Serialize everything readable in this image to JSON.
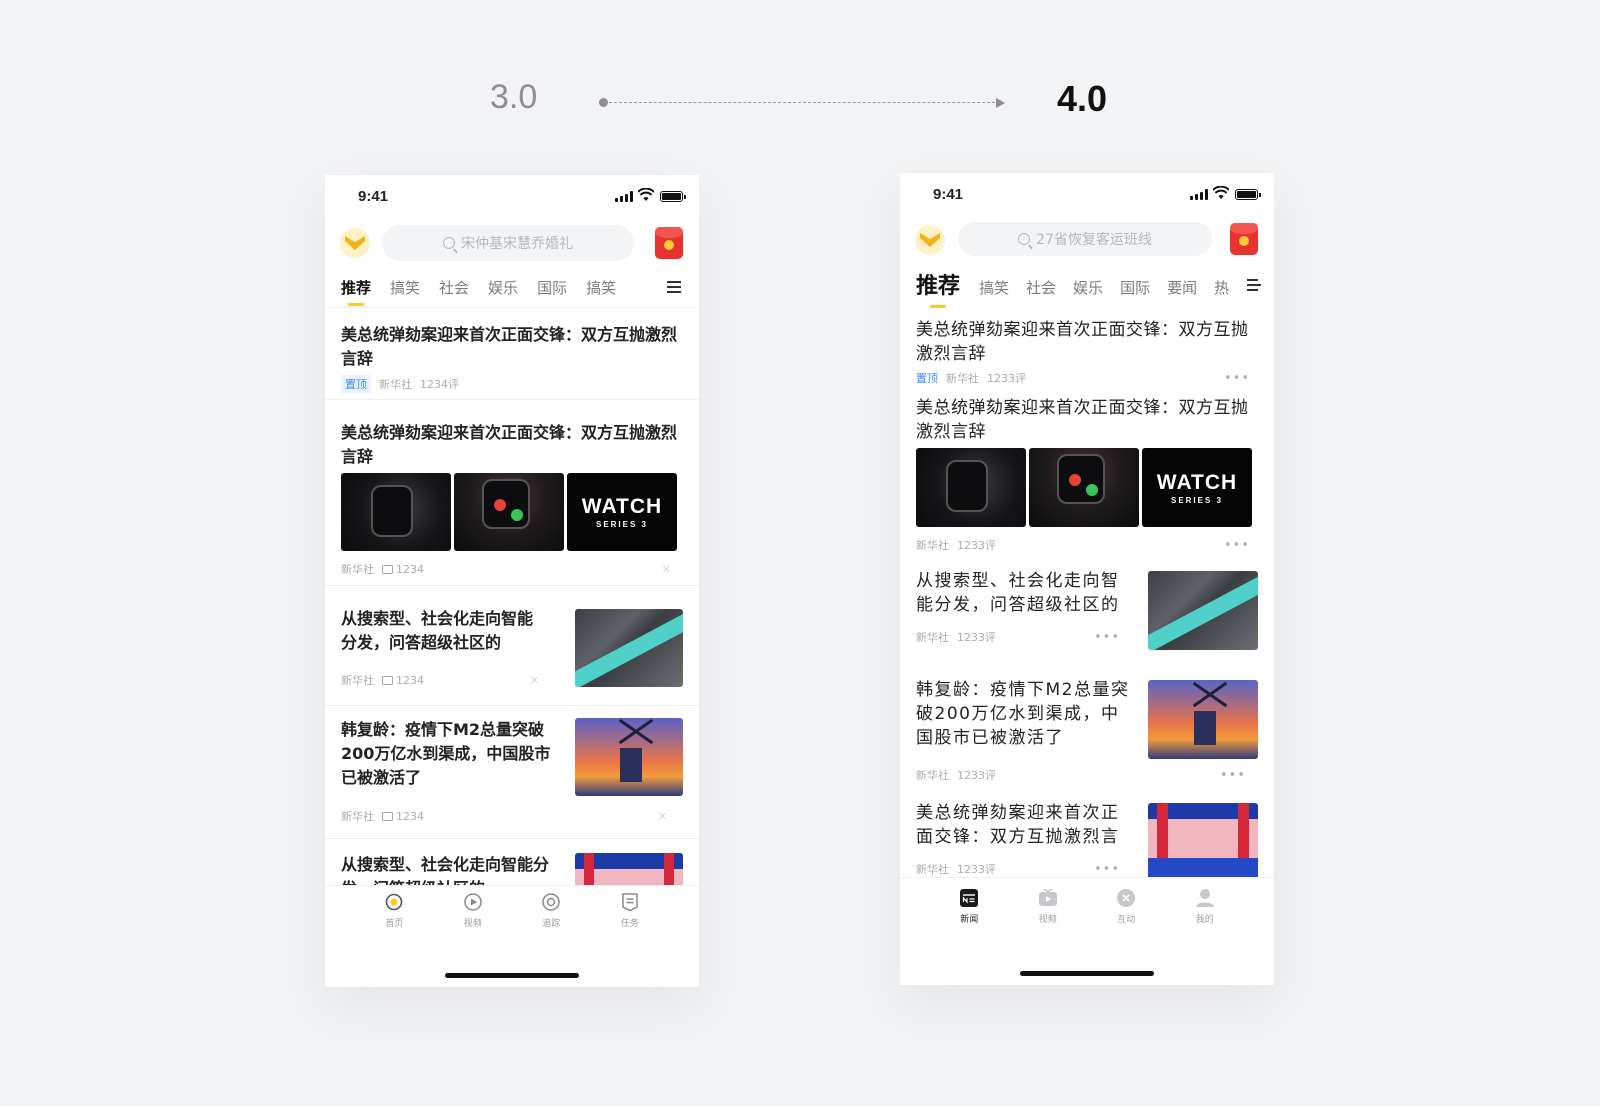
{
  "header": {
    "old_version": "3.0",
    "new_version": "4.0"
  },
  "old": {
    "time": "9:41",
    "search_placeholder": "宋仲基宋慧乔婚礼",
    "tabs": [
      "推荐",
      "搞笑",
      "社会",
      "娱乐",
      "国际",
      "搞笑"
    ],
    "articles": [
      {
        "title": "美总统弹劾案迎来首次正面交锋：双方互抛激烈言辞",
        "tag": "置顶",
        "source": "新华社",
        "comments": "1234评"
      },
      {
        "title": "美总统弹劾案迎来首次正面交锋：双方互抛激烈言辞",
        "source": "新华社",
        "comments": "1234"
      },
      {
        "title": "从搜索型、社会化走向智能分发，问答超级社区的",
        "source": "新华社",
        "comments": "1234"
      },
      {
        "title": "韩复龄：疫情下M2总量突破200万亿水到渠成，中国股市已被激活了",
        "source": "新华社",
        "comments": "1234"
      },
      {
        "title": "从搜索型、社会化走向智能分发，问答超级社区的"
      }
    ],
    "watch_brand": "WATCH",
    "watch_series": "SERIES 3",
    "tabbar": [
      "首页",
      "视频",
      "追踪",
      "任务"
    ]
  },
  "new": {
    "time": "9:41",
    "search_placeholder": "27省恢复客运班线",
    "tabs": [
      "推荐",
      "搞笑",
      "社会",
      "娱乐",
      "国际",
      "要闻",
      "热"
    ],
    "articles": [
      {
        "title": "美总统弹劾案迎来首次正面交锋：双方互抛激烈言辞",
        "tag": "置顶",
        "source": "新华社",
        "comments": "1233评"
      },
      {
        "title": "美总统弹劾案迎来首次正面交锋：双方互抛激烈言辞",
        "source": "新华社",
        "comments": "1233评"
      },
      {
        "title": "从搜索型、社会化走向智能分发，问答超级社区的",
        "source": "新华社",
        "comments": "1233评"
      },
      {
        "title": "韩复龄：疫情下M2总量突破200万亿水到渠成，中国股市已被激活了",
        "source": "新华社",
        "comments": "1233评"
      },
      {
        "title": "美总统弹劾案迎来首次正面交锋：双方互抛激烈言",
        "source": "新华社",
        "comments": "1233评"
      }
    ],
    "watch_brand": "WATCH",
    "watch_series": "SERIES 3",
    "tabbar": [
      "新闻",
      "视频",
      "互动",
      "我的"
    ]
  },
  "icons": {
    "more": "•••",
    "close": "✕"
  },
  "colors": {
    "accent": "#ffc728",
    "tag_blue": "#3b8cf7",
    "red_packet": "#e8322f"
  }
}
